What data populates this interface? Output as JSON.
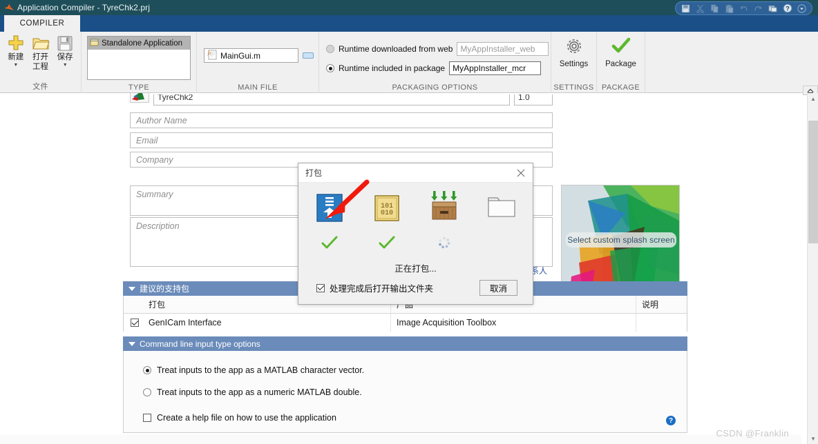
{
  "window": {
    "title": "Application Compiler - TyreChk2.prj",
    "app_icon": "matlab-icon",
    "minimize": "minimize-icon",
    "maximize": "maximize-icon",
    "close": "close-icon"
  },
  "quick_access": {
    "items": [
      {
        "name": "save-icon",
        "label": "Save"
      },
      {
        "name": "cut-icon",
        "label": "Cut"
      },
      {
        "name": "copy-icon",
        "label": "Copy"
      },
      {
        "name": "paste-icon",
        "label": "Paste"
      },
      {
        "name": "undo-icon",
        "label": "Undo"
      },
      {
        "name": "redo-icon",
        "label": "Redo"
      },
      {
        "name": "window-icon",
        "label": "Window"
      },
      {
        "name": "help-icon",
        "label": "Help"
      },
      {
        "name": "dropdown-icon",
        "label": "More"
      }
    ]
  },
  "ribbon": {
    "tab": "COMPILER",
    "groups": {
      "file": {
        "label": "文件",
        "buttons": [
          {
            "label_top": "新建",
            "label_bottom": "",
            "icon": "new-plus-icon",
            "has_caret": true
          },
          {
            "label_top": "打开",
            "label_bottom": "工程",
            "icon": "open-folder-icon",
            "has_caret": false
          },
          {
            "label_top": "保存",
            "label_bottom": "",
            "icon": "save-disk-icon",
            "has_caret": true
          }
        ]
      },
      "type": {
        "label": "TYPE",
        "selected_item": "Standalone Application",
        "item_icon": "app-window-icon"
      },
      "main_file": {
        "label": "MAIN FILE",
        "file": "MainGui.m",
        "file_icon": "m-file-icon"
      },
      "packaging": {
        "label": "PACKAGING OPTIONS",
        "option_web": {
          "label": "Runtime downloaded from web",
          "selected": false,
          "value": "MyAppInstaller_web"
        },
        "option_included": {
          "label": "Runtime included in package",
          "selected": true,
          "value": "MyAppInstaller_mcr"
        }
      },
      "settings": {
        "label": "SETTINGS",
        "button": "Settings",
        "icon": "gear-icon"
      },
      "package": {
        "label": "PACKAGE",
        "button": "Package",
        "icon": "green-check-icon"
      }
    }
  },
  "form": {
    "app_name_value": "TyreChk2",
    "app_version_value": "1.0",
    "author_placeholder": "Author Name",
    "email_placeholder": "Email",
    "company_placeholder": "Company",
    "summary_placeholder": "Summary",
    "description_placeholder": "Description",
    "contact_link": "联系人",
    "splash_caption": "Select custom splash screen"
  },
  "support_packages": {
    "section_title": "建议的支持包",
    "columns": [
      "打包",
      "产品",
      "说明"
    ],
    "rows": [
      {
        "checked": true,
        "package": "GenICam Interface",
        "product": "Image Acquisition Toolbox",
        "description": ""
      }
    ]
  },
  "cmdline": {
    "section_title": "Command line input type options",
    "options": [
      {
        "label": "Treat inputs to the app as a MATLAB character vector.",
        "selected": true
      },
      {
        "label": "Treat inputs to the app as a numeric MATLAB double.",
        "selected": false
      }
    ],
    "checkbox": {
      "label": "Create a help file on how to use the application",
      "checked": false
    },
    "help_icon": "help-circle-icon"
  },
  "dialog": {
    "title": "打包",
    "close_icon": "close-icon",
    "steps": [
      {
        "icon": "blue-download-icon",
        "state": "done",
        "mark": "check"
      },
      {
        "icon": "binary-code-icon",
        "state": "done",
        "mark": "check"
      },
      {
        "icon": "package-box-icon",
        "state": "running",
        "mark": "spinner"
      },
      {
        "icon": "folder-icon",
        "state": "pending",
        "mark": "none"
      }
    ],
    "status_text": "正在打包...",
    "open_folder_checkbox": {
      "label": "处理完成后打开输出文件夹",
      "checked": true
    },
    "cancel_button": "取消",
    "annotation": "red-arrow"
  },
  "watermark": "CSDN @Franklin",
  "colors": {
    "titlebar": "#1e4e5a",
    "tabstrip": "#1b4f87",
    "section_bar": "#6b8cba",
    "accent_link": "#2b4f9e",
    "arrow_red": "#f01a0c",
    "check_green": "#5cb82e"
  }
}
